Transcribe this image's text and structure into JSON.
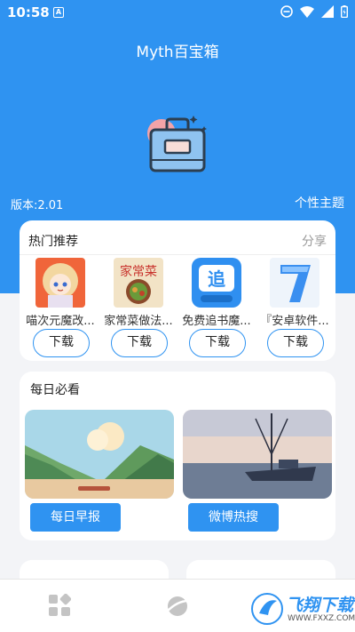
{
  "status_bar": {
    "time": "10:58",
    "notification_icon": "a-notification-icon"
  },
  "app": {
    "title": "Myth百宝箱",
    "version": "版本:2.01",
    "theme_link": "个性主题"
  },
  "hot": {
    "title": "热门推荐",
    "share": "分享",
    "items": [
      {
        "name": "喵次元魔改...",
        "button": "下载",
        "icon": "anime-girl-icon"
      },
      {
        "name": "家常菜做法...",
        "button": "下载",
        "icon": "home-cooking-icon"
      },
      {
        "name": "免费追书魔...",
        "button": "下载",
        "icon": "book-reader-icon"
      },
      {
        "name": "『安卓软件...",
        "button": "下载",
        "icon": "android-software-icon"
      }
    ]
  },
  "daily": {
    "title": "每日必看",
    "left_button": "每日早报",
    "right_button": "微博热搜"
  },
  "watermark": {
    "text": "飞翔下载",
    "url": "WWW.FXXZ.COM"
  },
  "colors": {
    "accent": "#2f93f1",
    "background": "#f3f4f7"
  }
}
